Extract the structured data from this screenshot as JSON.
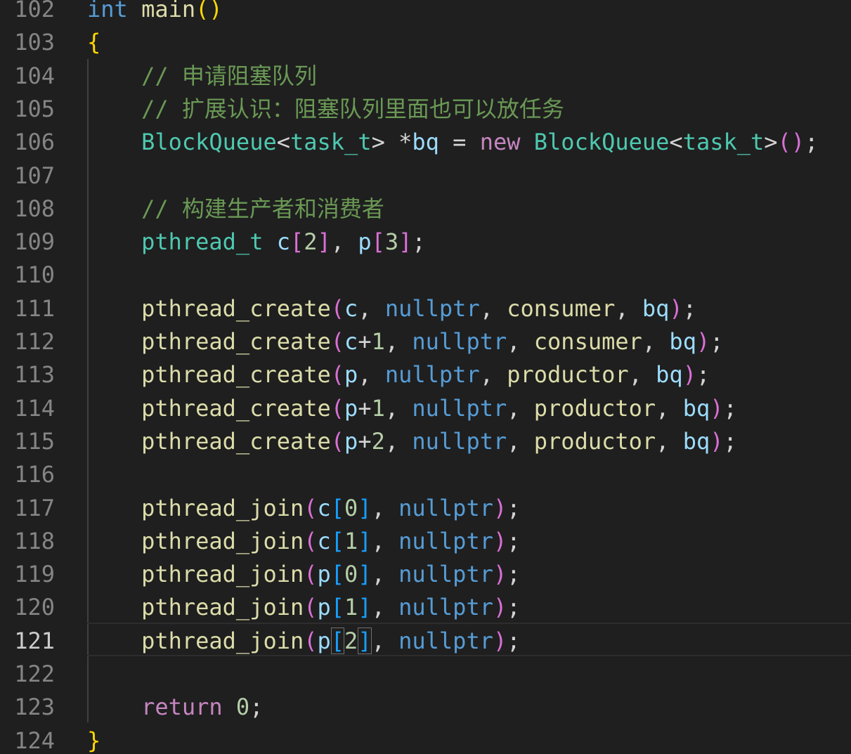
{
  "editor": {
    "active_line": "121",
    "lines": [
      {
        "num": "102",
        "tokens": [
          [
            "int",
            "keyword"
          ],
          [
            " ",
            "punct"
          ],
          [
            "main",
            "func"
          ],
          [
            "(",
            "paren0"
          ],
          [
            ")",
            "paren0"
          ]
        ]
      },
      {
        "num": "103",
        "tokens": [
          [
            "{",
            "paren0"
          ]
        ]
      },
      {
        "num": "104",
        "tokens": [
          [
            "    ",
            "punct"
          ],
          [
            "// 申请阻塞队列",
            "comment"
          ]
        ]
      },
      {
        "num": "105",
        "tokens": [
          [
            "    ",
            "punct"
          ],
          [
            "// 扩展认识：阻塞队列里面也可以放任务",
            "comment"
          ]
        ]
      },
      {
        "num": "106",
        "tokens": [
          [
            "    ",
            "punct"
          ],
          [
            "BlockQueue",
            "type"
          ],
          [
            "<",
            "punct"
          ],
          [
            "task_t",
            "type"
          ],
          [
            "> *",
            "punct"
          ],
          [
            "bq",
            "var"
          ],
          [
            " = ",
            "punct"
          ],
          [
            "new",
            "control"
          ],
          [
            " ",
            "punct"
          ],
          [
            "BlockQueue",
            "type"
          ],
          [
            "<",
            "punct"
          ],
          [
            "task_t",
            "type"
          ],
          [
            ">",
            "punct"
          ],
          [
            "(",
            "paren1"
          ],
          [
            ")",
            "paren1"
          ],
          [
            ";",
            "punct"
          ]
        ]
      },
      {
        "num": "107",
        "tokens": []
      },
      {
        "num": "108",
        "tokens": [
          [
            "    ",
            "punct"
          ],
          [
            "// 构建生产者和消费者",
            "comment"
          ]
        ]
      },
      {
        "num": "109",
        "tokens": [
          [
            "    ",
            "punct"
          ],
          [
            "pthread_t",
            "type"
          ],
          [
            " ",
            "punct"
          ],
          [
            "c",
            "var"
          ],
          [
            "[",
            "paren1"
          ],
          [
            "2",
            "number"
          ],
          [
            "]",
            "paren1"
          ],
          [
            ", ",
            "punct"
          ],
          [
            "p",
            "var"
          ],
          [
            "[",
            "paren1"
          ],
          [
            "3",
            "number"
          ],
          [
            "]",
            "paren1"
          ],
          [
            ";",
            "punct"
          ]
        ]
      },
      {
        "num": "110",
        "tokens": []
      },
      {
        "num": "111",
        "tokens": [
          [
            "    ",
            "punct"
          ],
          [
            "pthread_create",
            "func"
          ],
          [
            "(",
            "paren1"
          ],
          [
            "c",
            "var"
          ],
          [
            ", ",
            "punct"
          ],
          [
            "nullptr",
            "const"
          ],
          [
            ", ",
            "punct"
          ],
          [
            "consumer",
            "func"
          ],
          [
            ", ",
            "punct"
          ],
          [
            "bq",
            "var"
          ],
          [
            ")",
            "paren1"
          ],
          [
            ";",
            "punct"
          ]
        ]
      },
      {
        "num": "112",
        "tokens": [
          [
            "    ",
            "punct"
          ],
          [
            "pthread_create",
            "func"
          ],
          [
            "(",
            "paren1"
          ],
          [
            "c",
            "var"
          ],
          [
            "+",
            "punct"
          ],
          [
            "1",
            "number"
          ],
          [
            ", ",
            "punct"
          ],
          [
            "nullptr",
            "const"
          ],
          [
            ", ",
            "punct"
          ],
          [
            "consumer",
            "func"
          ],
          [
            ", ",
            "punct"
          ],
          [
            "bq",
            "var"
          ],
          [
            ")",
            "paren1"
          ],
          [
            ";",
            "punct"
          ]
        ]
      },
      {
        "num": "113",
        "tokens": [
          [
            "    ",
            "punct"
          ],
          [
            "pthread_create",
            "func"
          ],
          [
            "(",
            "paren1"
          ],
          [
            "p",
            "var"
          ],
          [
            ", ",
            "punct"
          ],
          [
            "nullptr",
            "const"
          ],
          [
            ", ",
            "punct"
          ],
          [
            "productor",
            "func"
          ],
          [
            ", ",
            "punct"
          ],
          [
            "bq",
            "var"
          ],
          [
            ")",
            "paren1"
          ],
          [
            ";",
            "punct"
          ]
        ]
      },
      {
        "num": "114",
        "tokens": [
          [
            "    ",
            "punct"
          ],
          [
            "pthread_create",
            "func"
          ],
          [
            "(",
            "paren1"
          ],
          [
            "p",
            "var"
          ],
          [
            "+",
            "punct"
          ],
          [
            "1",
            "number"
          ],
          [
            ", ",
            "punct"
          ],
          [
            "nullptr",
            "const"
          ],
          [
            ", ",
            "punct"
          ],
          [
            "productor",
            "func"
          ],
          [
            ", ",
            "punct"
          ],
          [
            "bq",
            "var"
          ],
          [
            ")",
            "paren1"
          ],
          [
            ";",
            "punct"
          ]
        ]
      },
      {
        "num": "115",
        "tokens": [
          [
            "    ",
            "punct"
          ],
          [
            "pthread_create",
            "func"
          ],
          [
            "(",
            "paren1"
          ],
          [
            "p",
            "var"
          ],
          [
            "+",
            "punct"
          ],
          [
            "2",
            "number"
          ],
          [
            ", ",
            "punct"
          ],
          [
            "nullptr",
            "const"
          ],
          [
            ", ",
            "punct"
          ],
          [
            "productor",
            "func"
          ],
          [
            ", ",
            "punct"
          ],
          [
            "bq",
            "var"
          ],
          [
            ")",
            "paren1"
          ],
          [
            ";",
            "punct"
          ]
        ]
      },
      {
        "num": "116",
        "tokens": []
      },
      {
        "num": "117",
        "tokens": [
          [
            "    ",
            "punct"
          ],
          [
            "pthread_join",
            "func"
          ],
          [
            "(",
            "paren1"
          ],
          [
            "c",
            "var"
          ],
          [
            "[",
            "paren2"
          ],
          [
            "0",
            "number"
          ],
          [
            "]",
            "paren2"
          ],
          [
            ", ",
            "punct"
          ],
          [
            "nullptr",
            "const"
          ],
          [
            ")",
            "paren1"
          ],
          [
            ";",
            "punct"
          ]
        ]
      },
      {
        "num": "118",
        "tokens": [
          [
            "    ",
            "punct"
          ],
          [
            "pthread_join",
            "func"
          ],
          [
            "(",
            "paren1"
          ],
          [
            "c",
            "var"
          ],
          [
            "[",
            "paren2"
          ],
          [
            "1",
            "number"
          ],
          [
            "]",
            "paren2"
          ],
          [
            ", ",
            "punct"
          ],
          [
            "nullptr",
            "const"
          ],
          [
            ")",
            "paren1"
          ],
          [
            ";",
            "punct"
          ]
        ]
      },
      {
        "num": "119",
        "tokens": [
          [
            "    ",
            "punct"
          ],
          [
            "pthread_join",
            "func"
          ],
          [
            "(",
            "paren1"
          ],
          [
            "p",
            "var"
          ],
          [
            "[",
            "paren2"
          ],
          [
            "0",
            "number"
          ],
          [
            "]",
            "paren2"
          ],
          [
            ", ",
            "punct"
          ],
          [
            "nullptr",
            "const"
          ],
          [
            ")",
            "paren1"
          ],
          [
            ";",
            "punct"
          ]
        ]
      },
      {
        "num": "120",
        "tokens": [
          [
            "    ",
            "punct"
          ],
          [
            "pthread_join",
            "func"
          ],
          [
            "(",
            "paren1"
          ],
          [
            "p",
            "var"
          ],
          [
            "[",
            "paren2"
          ],
          [
            "1",
            "number"
          ],
          [
            "]",
            "paren2"
          ],
          [
            ", ",
            "punct"
          ],
          [
            "nullptr",
            "const"
          ],
          [
            ")",
            "paren1"
          ],
          [
            ";",
            "punct"
          ]
        ]
      },
      {
        "num": "121",
        "tokens": [
          [
            "    ",
            "punct"
          ],
          [
            "pthread_join",
            "func"
          ],
          [
            "(",
            "paren1"
          ],
          [
            "p",
            "var"
          ],
          [
            "[",
            "paren2-box"
          ],
          [
            "2",
            "number"
          ],
          [
            "]",
            "paren2-box"
          ],
          [
            ", ",
            "punct"
          ],
          [
            "nullptr",
            "const"
          ],
          [
            ")",
            "paren1"
          ],
          [
            ";",
            "punct"
          ]
        ]
      },
      {
        "num": "122",
        "tokens": []
      },
      {
        "num": "123",
        "tokens": [
          [
            "    ",
            "punct"
          ],
          [
            "return",
            "control"
          ],
          [
            " ",
            "punct"
          ],
          [
            "0",
            "number"
          ],
          [
            ";",
            "punct"
          ]
        ]
      },
      {
        "num": "124",
        "tokens": [
          [
            "}",
            "paren0"
          ]
        ]
      }
    ]
  },
  "colors": {
    "background": "#1f1f1f",
    "line_number": "#858585",
    "line_number_active": "#cccccc",
    "keyword": "#569cd6",
    "function": "#dcdcaa",
    "comment": "#6a9955",
    "type": "#4ec9b0",
    "variable": "#9cdcfe",
    "control": "#c586c0",
    "number": "#b5cea8",
    "bracket_level_1": "#ffd700",
    "bracket_level_2": "#da70d6",
    "bracket_level_3": "#179fff"
  }
}
